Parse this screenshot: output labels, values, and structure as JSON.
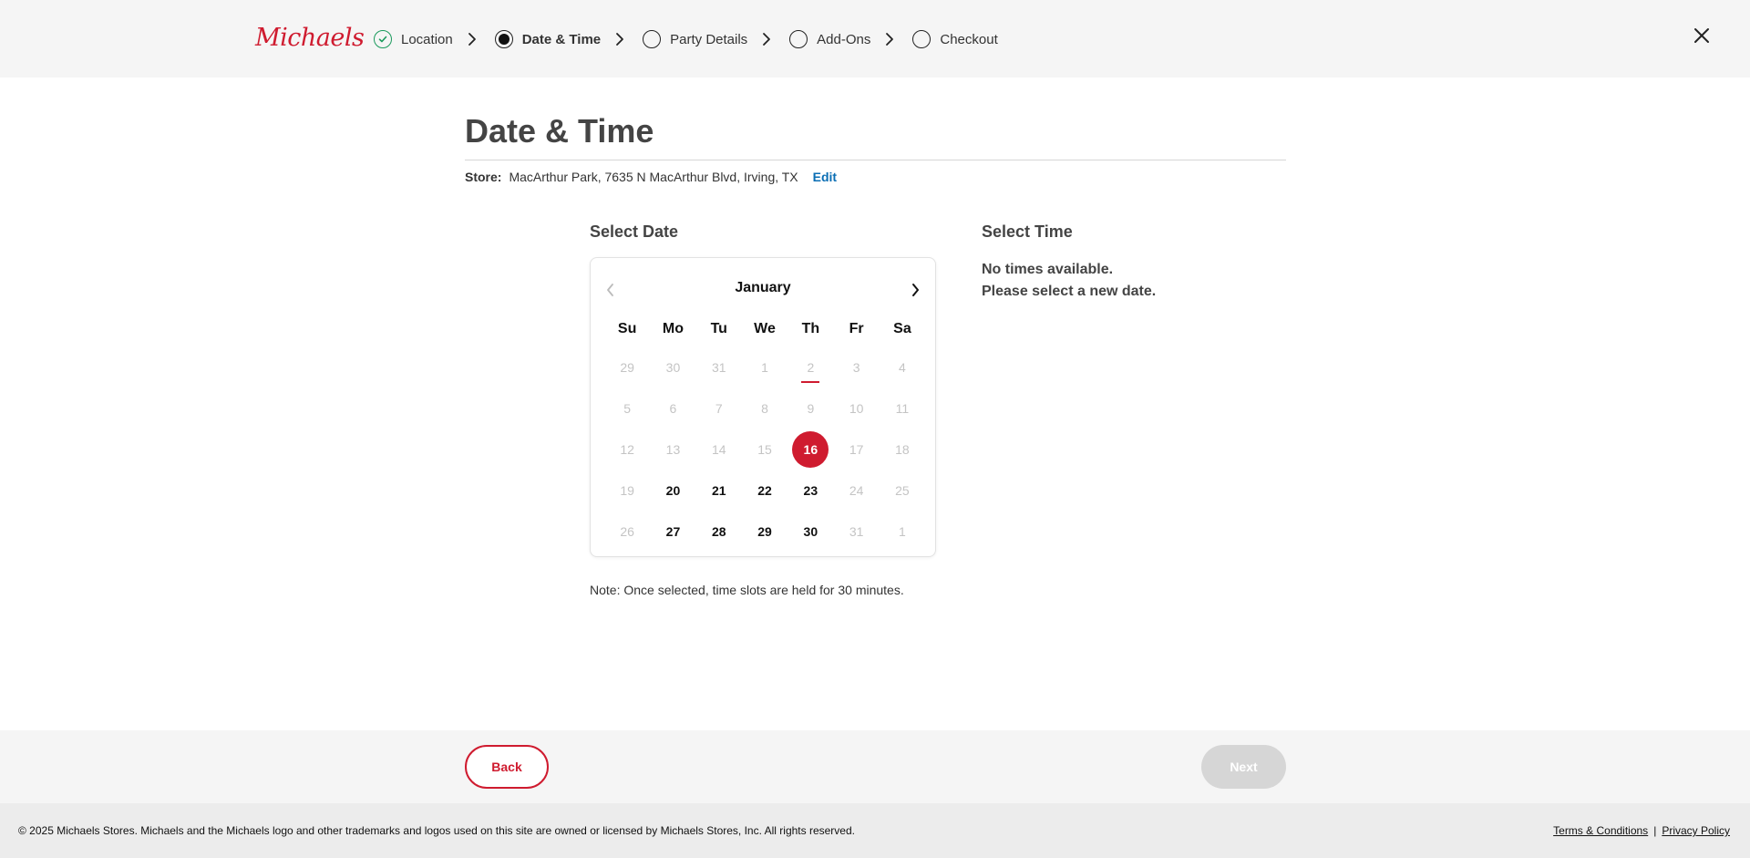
{
  "header": {
    "logo": "Michaels",
    "steps": [
      {
        "label": "Location",
        "state": "done"
      },
      {
        "label": "Date & Time",
        "state": "active"
      },
      {
        "label": "Party Details",
        "state": "todo"
      },
      {
        "label": "Add-Ons",
        "state": "todo"
      },
      {
        "label": "Checkout",
        "state": "todo"
      }
    ],
    "close_icon": "close-icon"
  },
  "page": {
    "title": "Date & Time",
    "store_label": "Store:",
    "store_value": "MacArthur Park, 7635 N MacArthur Blvd, Irving, TX",
    "edit_label": "Edit"
  },
  "date_section": {
    "title": "Select Date",
    "month": "January",
    "weekdays": [
      "Su",
      "Mo",
      "Tu",
      "We",
      "Th",
      "Fr",
      "Sa"
    ],
    "weeks": [
      [
        {
          "d": "29",
          "s": "dis"
        },
        {
          "d": "30",
          "s": "dis"
        },
        {
          "d": "31",
          "s": "dis"
        },
        {
          "d": "1",
          "s": "dis"
        },
        {
          "d": "2",
          "s": "today"
        },
        {
          "d": "3",
          "s": "dis"
        },
        {
          "d": "4",
          "s": "dis"
        }
      ],
      [
        {
          "d": "5",
          "s": "dis"
        },
        {
          "d": "6",
          "s": "dis"
        },
        {
          "d": "7",
          "s": "dis"
        },
        {
          "d": "8",
          "s": "dis"
        },
        {
          "d": "9",
          "s": "dis"
        },
        {
          "d": "10",
          "s": "dis"
        },
        {
          "d": "11",
          "s": "dis"
        }
      ],
      [
        {
          "d": "12",
          "s": "dis"
        },
        {
          "d": "13",
          "s": "dis"
        },
        {
          "d": "14",
          "s": "dis"
        },
        {
          "d": "15",
          "s": "dis"
        },
        {
          "d": "16",
          "s": "sel"
        },
        {
          "d": "17",
          "s": "dis"
        },
        {
          "d": "18",
          "s": "dis"
        }
      ],
      [
        {
          "d": "19",
          "s": "dis"
        },
        {
          "d": "20",
          "s": "avail"
        },
        {
          "d": "21",
          "s": "avail"
        },
        {
          "d": "22",
          "s": "avail"
        },
        {
          "d": "23",
          "s": "avail"
        },
        {
          "d": "24",
          "s": "dis"
        },
        {
          "d": "25",
          "s": "dis"
        }
      ],
      [
        {
          "d": "26",
          "s": "dis"
        },
        {
          "d": "27",
          "s": "avail"
        },
        {
          "d": "28",
          "s": "avail"
        },
        {
          "d": "29",
          "s": "avail"
        },
        {
          "d": "30",
          "s": "avail"
        },
        {
          "d": "31",
          "s": "dis"
        },
        {
          "d": "1",
          "s": "dis"
        }
      ]
    ],
    "note": "Note: Once selected, time slots are held for 30 minutes."
  },
  "time_section": {
    "title": "Select Time",
    "msg_line1": "No times available.",
    "msg_line2": "Please select a new date."
  },
  "nav": {
    "back_label": "Back",
    "next_label": "Next"
  },
  "footer": {
    "copyright": "© 2025 Michaels Stores. Michaels and the Michaels logo and other trademarks and logos used on this site are owned or licensed by Michaels Stores, Inc. All rights reserved.",
    "terms": "Terms & Conditions",
    "separator": "|",
    "privacy": "Privacy Policy"
  },
  "colors": {
    "brand_red": "#cf1b2f",
    "check_green": "#1a9a5c",
    "link_blue": "#0a6eb4"
  }
}
